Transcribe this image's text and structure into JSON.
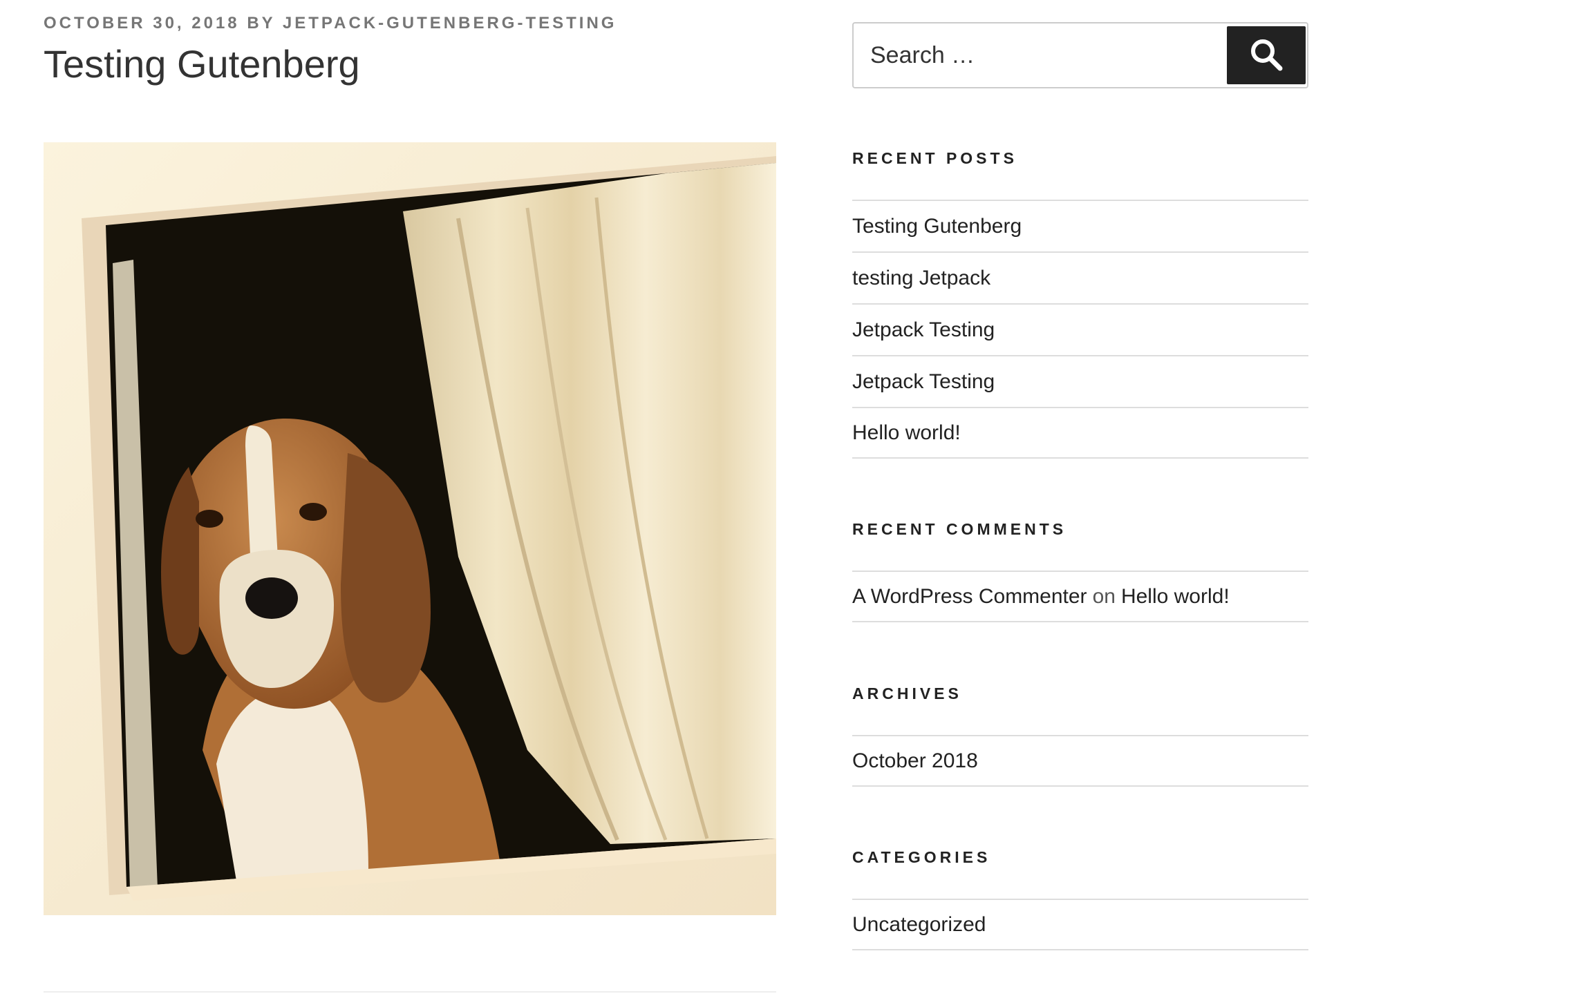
{
  "post": {
    "date": "OCTOBER 30, 2018",
    "by": "BY",
    "author": "JETPACK-GUTENBERG-TESTING",
    "title": "Testing Gutenberg",
    "image_alt": "Beagle sitting behind a car window"
  },
  "search": {
    "placeholder": "Search …",
    "button_icon": "search-icon"
  },
  "recent_posts": {
    "title": "RECENT POSTS",
    "items": [
      "Testing Gutenberg",
      "testing Jetpack",
      "Jetpack Testing",
      "Jetpack Testing",
      "Hello world!"
    ]
  },
  "recent_comments": {
    "title": "RECENT COMMENTS",
    "author": "A WordPress Commenter",
    "on": "on",
    "post": "Hello world!"
  },
  "archives": {
    "title": "ARCHIVES",
    "items": [
      "October 2018"
    ]
  },
  "categories": {
    "title": "CATEGORIES",
    "items": [
      "Uncategorized"
    ]
  },
  "colors": {
    "meta_text": "#767676",
    "button_bg": "#222222",
    "divider": "#dddddd"
  }
}
